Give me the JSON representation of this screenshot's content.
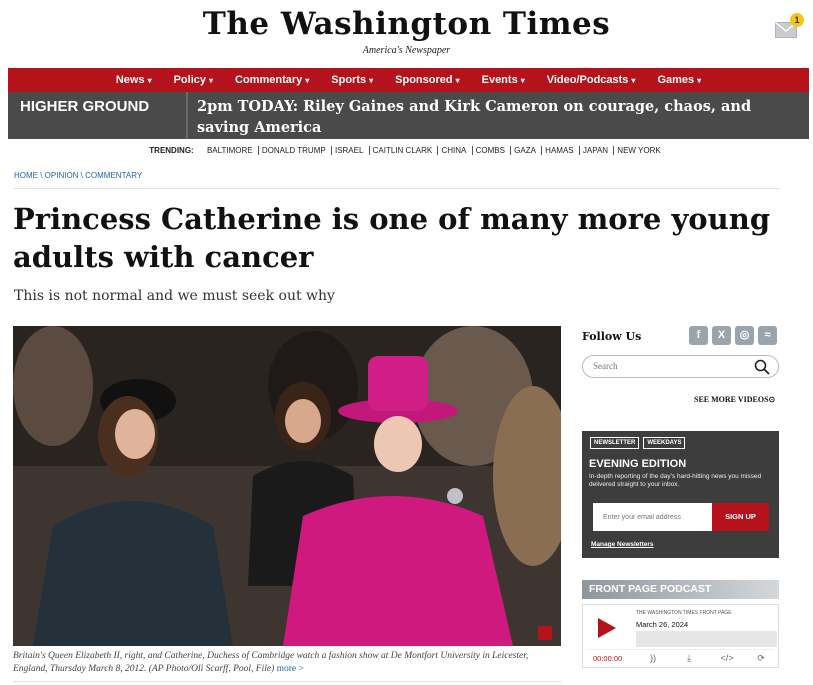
{
  "masthead": {
    "logo": "The Washington Times",
    "tagline": "America's Newspaper",
    "mail_badge_count": "1",
    "mail_icon": "envelope-icon"
  },
  "nav": {
    "items": [
      {
        "label": "News"
      },
      {
        "label": "Policy"
      },
      {
        "label": "Commentary"
      },
      {
        "label": "Sports"
      },
      {
        "label": "Sponsored"
      },
      {
        "label": "Events"
      },
      {
        "label": "Video/Podcasts"
      },
      {
        "label": "Games"
      }
    ],
    "background": "#b5121b"
  },
  "banner": {
    "label": "HIGHER GROUND",
    "text": "2pm TODAY: Riley Gaines and Kirk Cameron on courage, chaos, and saving America"
  },
  "trending": {
    "label": "TRENDING:",
    "items": [
      "BALTIMORE",
      "DONALD TRUMP",
      "ISRAEL",
      "CAITLIN CLARK",
      "CHINA",
      "COMBS",
      "GAZA",
      "HAMAS",
      "JAPAN",
      "NEW YORK"
    ]
  },
  "breadcrumb": {
    "items": [
      "HOME",
      "OPINION",
      "COMMENTARY"
    ],
    "separator": " \\ "
  },
  "article": {
    "headline": "Princess Catherine is one of many more young adults with cancer",
    "subhead": "This is not normal and we must seek out why",
    "caption": "Britain's Queen Elizabeth II, right, and Catherine, Duchess of Cambridge watch a fashion show at De Montfort University in Leicester, England, Thursday March 8, 2012. (AP Photo/Oli Scarff, Pool, File)",
    "caption_more": "more >"
  },
  "sidebar": {
    "follow_label": "Follow Us",
    "socials": [
      {
        "icon": "facebook-icon",
        "glyph": "f"
      },
      {
        "icon": "x-icon",
        "glyph": "X"
      },
      {
        "icon": "instagram-icon",
        "glyph": "◎"
      },
      {
        "icon": "rss-icon",
        "glyph": "≈"
      }
    ],
    "search_placeholder": "Search",
    "see_more_videos": "SEE MORE VIDEOS⊙"
  },
  "newsletter": {
    "tags": [
      "NEWSLETTER",
      "WEEKDAYS"
    ],
    "title": "EVENING EDITION",
    "description": "In-depth reporting of the day's hard-hitting news you missed delivered straight to your inbox.",
    "email_placeholder": "Enter your email address",
    "signup_label": "SIGN UP",
    "manage_label": "Manage Newsletters"
  },
  "podcast": {
    "header": "FRONT PAGE PODCAST",
    "show": "THE WASHINGTON TIMES FRONT PAGE",
    "date": "March 26, 2024",
    "time": "00:00:00",
    "controls": [
      {
        "icon": "signal-icon",
        "glyph": "))"
      },
      {
        "icon": "download-icon",
        "glyph": "⤓"
      },
      {
        "icon": "embed-icon",
        "glyph": "</>"
      },
      {
        "icon": "share-icon",
        "glyph": "⟳"
      }
    ]
  }
}
